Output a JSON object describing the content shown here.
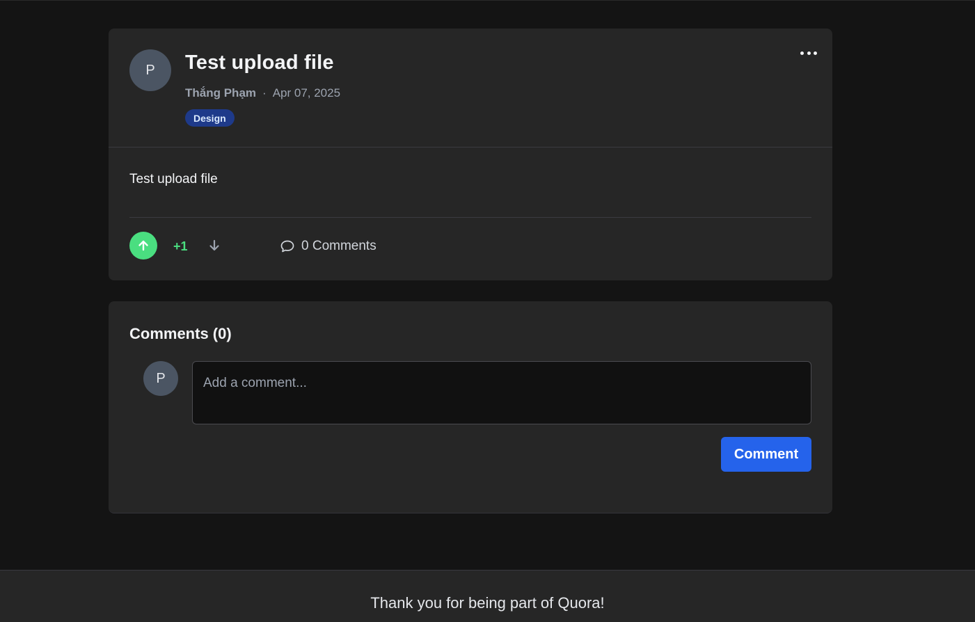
{
  "post": {
    "avatar_initial": "P",
    "title": "Test upload file",
    "author": "Thắng Phạm",
    "separator": "·",
    "date": "Apr 07, 2025",
    "tag": "Design",
    "body": "Test upload file",
    "vote_count": "+1",
    "comments_link": "0 Comments"
  },
  "comments": {
    "heading": "Comments (0)",
    "avatar_initial": "P",
    "input_placeholder": "Add a comment...",
    "submit_label": "Comment"
  },
  "footer": {
    "text": "Thank you for being part of Quora!"
  },
  "colors": {
    "background": "#141414",
    "card": "#262626",
    "upvote_active": "#4ade80",
    "primary_button": "#2563eb",
    "tag_background": "#1e3a8a"
  },
  "icons": {
    "more": "more-horizontal-icon",
    "upvote": "arrow-up-icon",
    "downvote": "arrow-down-icon",
    "comment": "comment-bubble-icon"
  }
}
